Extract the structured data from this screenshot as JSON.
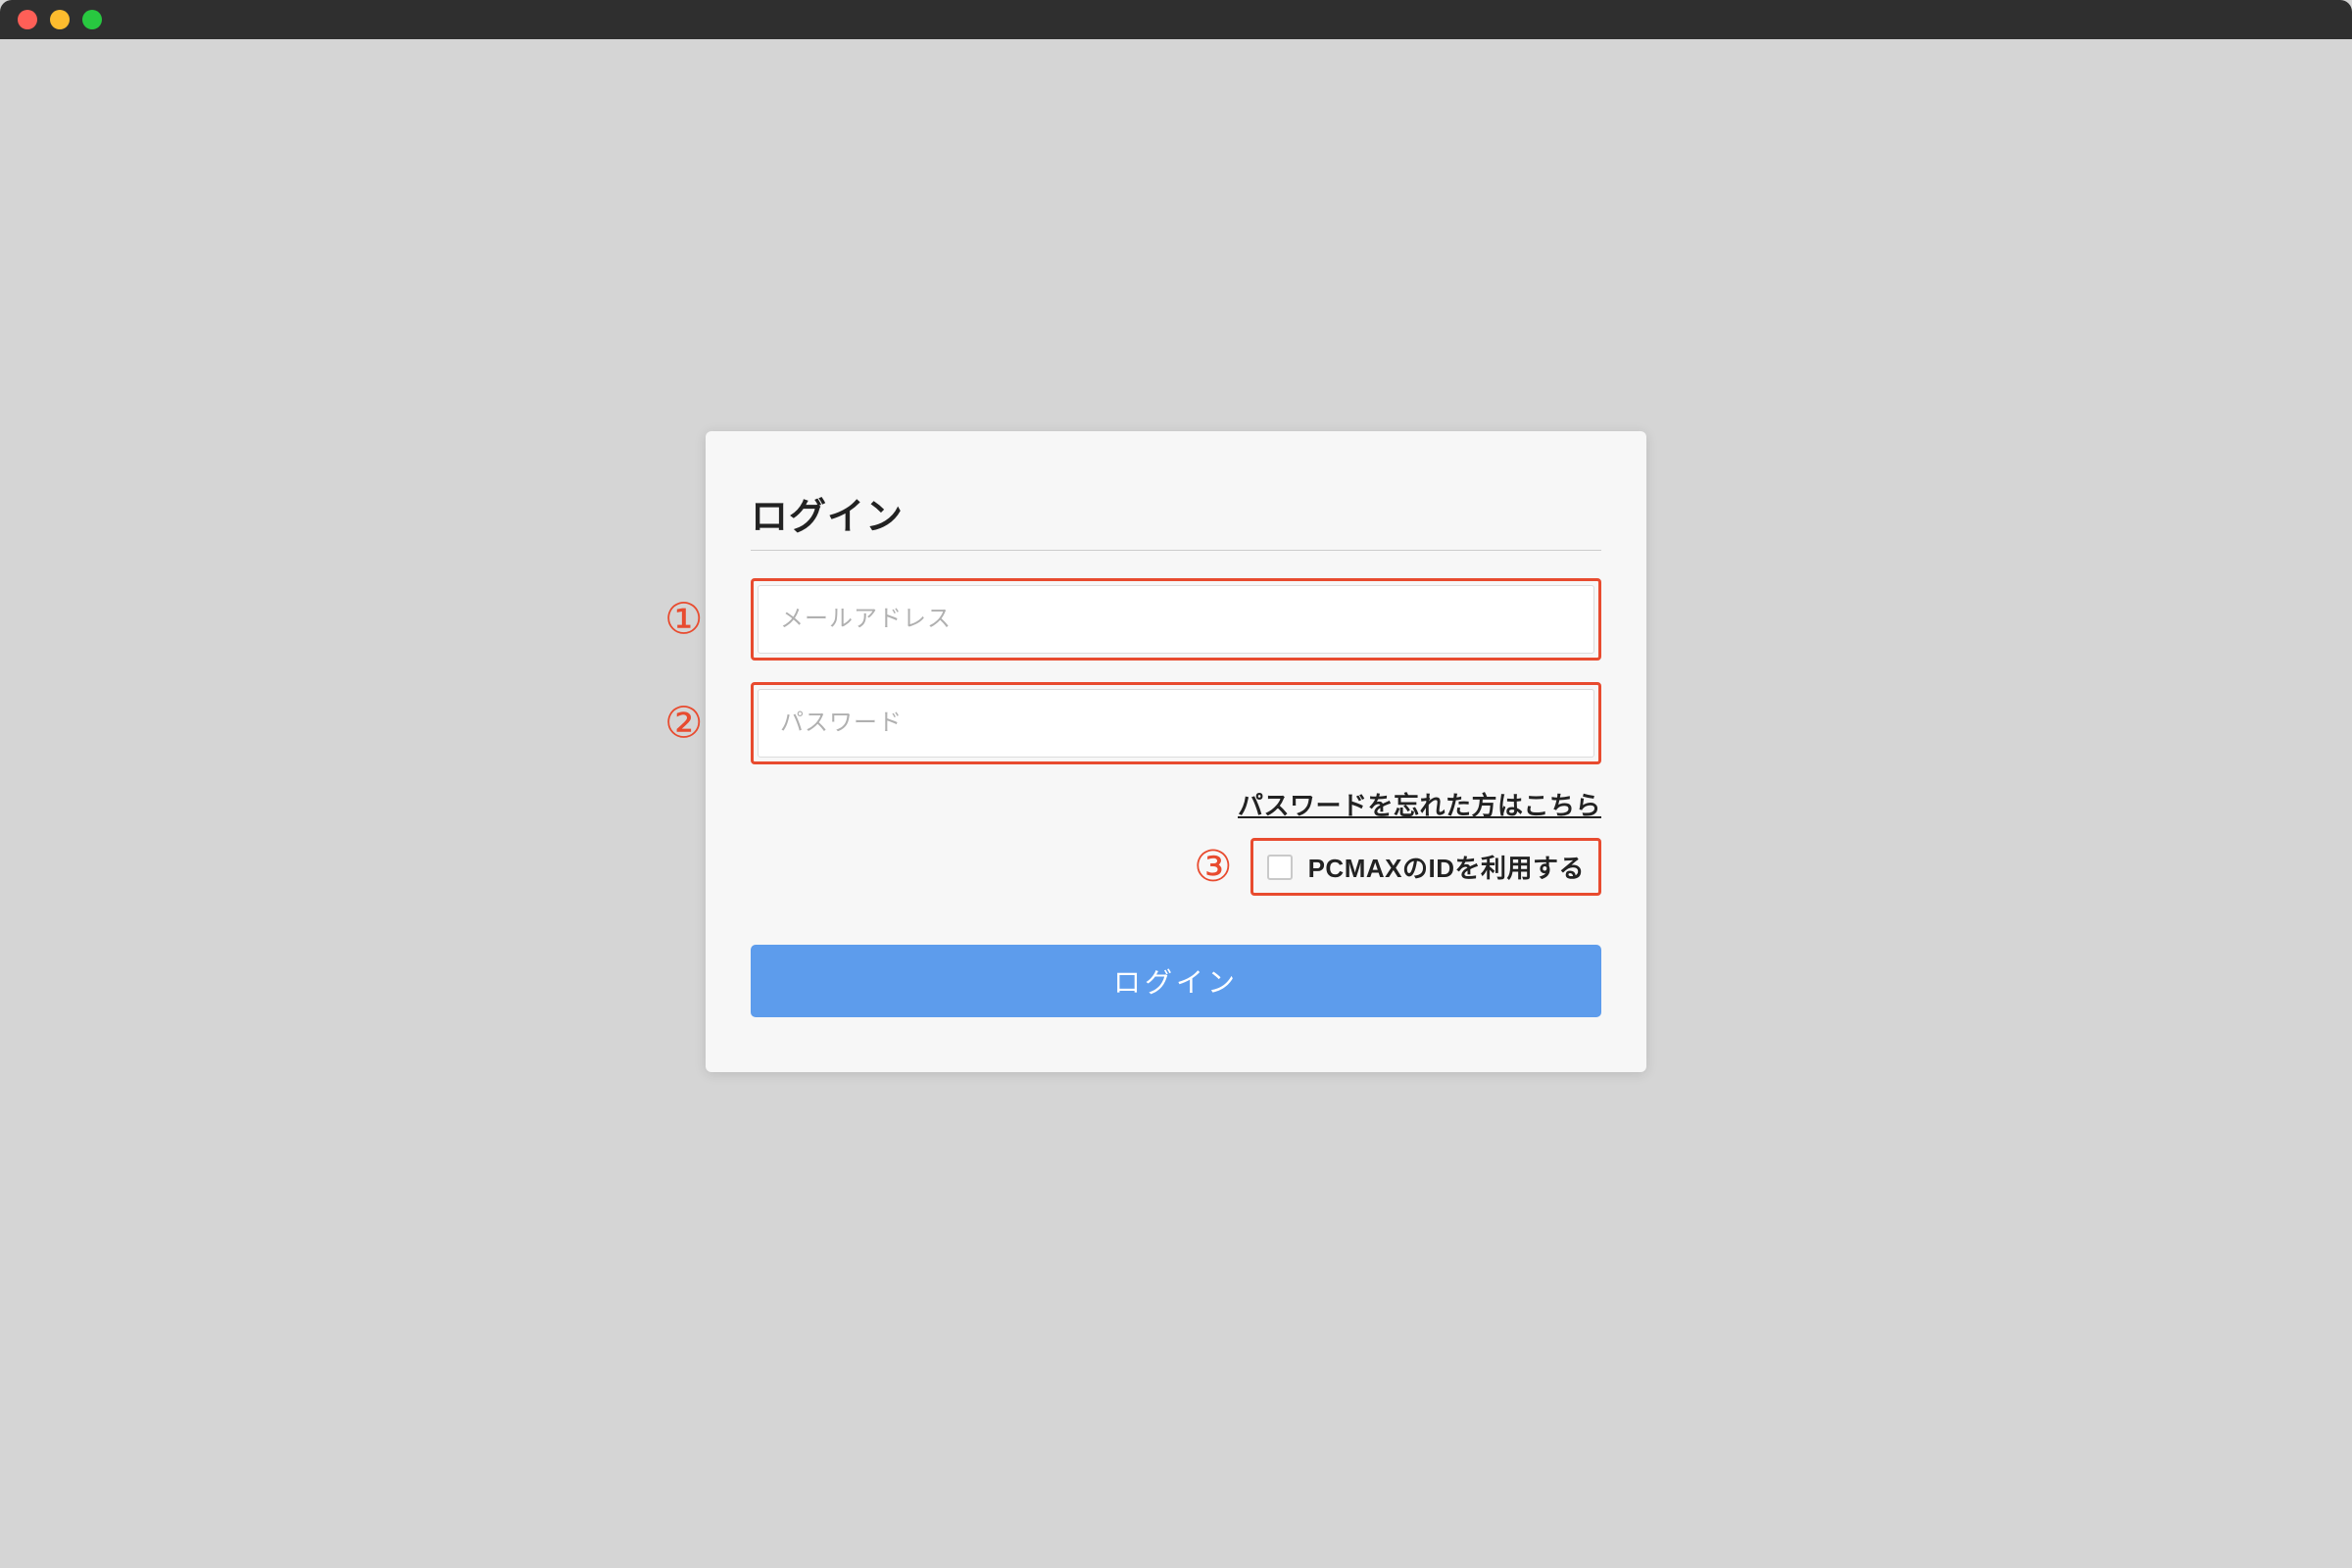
{
  "form": {
    "title": "ログイン",
    "email_placeholder": "メールアドレス",
    "password_placeholder": "パスワード",
    "forgot_link": "パスワードを忘れた方はこちら",
    "use_id_label": "PCMAXのIDを利用する",
    "submit_label": "ログイン"
  },
  "annotations": {
    "one": "①",
    "two": "②",
    "three": "③"
  }
}
